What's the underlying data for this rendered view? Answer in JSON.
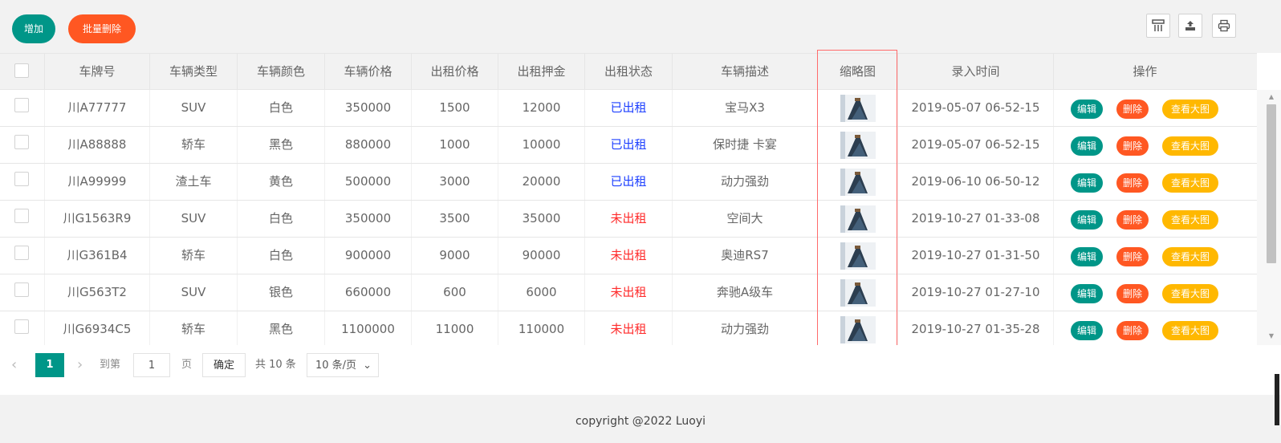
{
  "toolbar": {
    "add_label": "增加",
    "batch_delete_label": "批量删除",
    "icons": [
      "columns-icon",
      "export-icon",
      "print-icon"
    ]
  },
  "table": {
    "headers": [
      "车牌号",
      "车辆类型",
      "车辆颜色",
      "车辆价格",
      "出租价格",
      "出租押金",
      "出租状态",
      "车辆描述",
      "缩略图",
      "录入时间",
      "操作"
    ],
    "rows": [
      {
        "plate": "川A77777",
        "type": "SUV",
        "color": "白色",
        "price": "350000",
        "rent": "1500",
        "deposit": "12000",
        "status": "已出租",
        "desc": "宝马X3",
        "time": "2019-05-07 06-52-15"
      },
      {
        "plate": "川A88888",
        "type": "轿车",
        "color": "黑色",
        "price": "880000",
        "rent": "1000",
        "deposit": "10000",
        "status": "已出租",
        "desc": "保时捷 卡宴",
        "time": "2019-05-07 06-52-15"
      },
      {
        "plate": "川A99999",
        "type": "渣土车",
        "color": "黄色",
        "price": "500000",
        "rent": "3000",
        "deposit": "20000",
        "status": "已出租",
        "desc": "动力强劲",
        "time": "2019-06-10 06-50-12"
      },
      {
        "plate": "川G1563R9",
        "type": "SUV",
        "color": "白色",
        "price": "350000",
        "rent": "3500",
        "deposit": "35000",
        "status": "未出租",
        "desc": "空间大",
        "time": "2019-10-27 01-33-08"
      },
      {
        "plate": "川G361B4",
        "type": "轿车",
        "color": "白色",
        "price": "900000",
        "rent": "9000",
        "deposit": "90000",
        "status": "未出租",
        "desc": "奥迪RS7",
        "time": "2019-10-27 01-31-50"
      },
      {
        "plate": "川G563T2",
        "type": "SUV",
        "color": "银色",
        "price": "660000",
        "rent": "600",
        "deposit": "6000",
        "status": "未出租",
        "desc": "奔驰A级车",
        "time": "2019-10-27 01-27-10"
      },
      {
        "plate": "川G6934C5",
        "type": "轿车",
        "color": "黑色",
        "price": "1100000",
        "rent": "11000",
        "deposit": "110000",
        "status": "未出租",
        "desc": "动力强劲",
        "time": "2019-10-27 01-35-28"
      }
    ],
    "actions": {
      "edit": "编辑",
      "delete": "删除",
      "view": "查看大图"
    }
  },
  "pagination": {
    "current_page": "1",
    "goto_label": "到第",
    "page_input": "1",
    "page_unit": "页",
    "confirm_label": "确定",
    "total": "共 10 条",
    "page_size": "10 条/页"
  },
  "footer": {
    "copyright": "copyright @2022 Luoyi"
  },
  "colors": {
    "primary": "#009688",
    "danger": "#ff5722",
    "warn": "#ffb800",
    "rented": "#1e40ff",
    "free": "#ff2b2b"
  }
}
